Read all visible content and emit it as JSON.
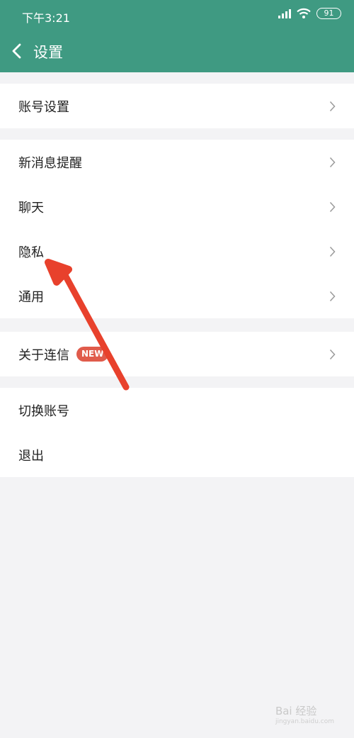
{
  "status_bar": {
    "time": "下午3:21",
    "battery": "91"
  },
  "header": {
    "title": "设置"
  },
  "groups": [
    {
      "items": [
        {
          "label": "账号设置"
        }
      ]
    },
    {
      "items": [
        {
          "label": "新消息提醒"
        },
        {
          "label": "聊天"
        },
        {
          "label": "隐私"
        },
        {
          "label": "通用"
        }
      ]
    },
    {
      "items": [
        {
          "label": "关于连信",
          "badge": "NEW"
        }
      ]
    },
    {
      "items": [
        {
          "label": "切换账号"
        },
        {
          "label": "退出"
        }
      ]
    }
  ],
  "watermark": {
    "text": "Bai 经验",
    "sub": "jingyan.baidu.com"
  },
  "colors": {
    "header_bg": "#3f9a82",
    "badge_bg": "#e05b4b",
    "annotation_arrow": "#e8412c",
    "page_bg": "#f3f3f5"
  },
  "icons": {
    "back": "chevron-left-icon",
    "row_arrow": "chevron-right-icon",
    "wifi": "wifi-icon",
    "signal": "signal-icon",
    "battery": "battery-icon"
  }
}
